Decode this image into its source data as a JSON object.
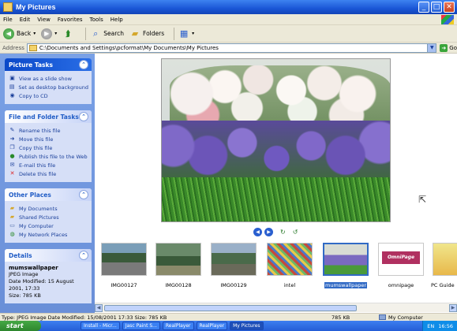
{
  "window": {
    "title": "My Pictures"
  },
  "menu": [
    "File",
    "Edit",
    "View",
    "Favorites",
    "Tools",
    "Help"
  ],
  "toolbar": {
    "back": "Back",
    "search": "Search",
    "folders": "Folders"
  },
  "address": {
    "label": "Address",
    "path": "C:\\Documents and Settings\\pcformat\\My Documents\\My Pictures",
    "go": "Go"
  },
  "picture_tasks": {
    "title": "Picture Tasks",
    "items": [
      "View as a slide show",
      "Set as desktop background",
      "Copy to CD"
    ]
  },
  "file_tasks": {
    "title": "File and Folder Tasks",
    "items": [
      "Rename this file",
      "Move this file",
      "Copy this file",
      "Publish this file to the Web",
      "E-mail this file",
      "Delete this file"
    ]
  },
  "other_places": {
    "title": "Other Places",
    "items": [
      "My Documents",
      "Shared Pictures",
      "My Computer",
      "My Network Places"
    ]
  },
  "details": {
    "title": "Details",
    "name": "mumswallpaper",
    "type": "JPEG Image",
    "modified": "Date Modified: 15 August 2001, 17:33",
    "size": "Size: 785 KB"
  },
  "thumbnails": [
    "IMG00127",
    "IMG00128",
    "IMG00129",
    "intel",
    "mumswallpaper",
    "omnipage",
    "PC Guide"
  ],
  "omnipage_logo": "OmniPage",
  "status": {
    "info": "Type: JPEG Image Date Modified: 15/08/2001 17:33 Size: 785 KB",
    "size": "785 KB",
    "location": "My Computer"
  },
  "taskbar": {
    "start": "start",
    "items": [
      "Install - Micr...",
      "Jasc Paint S...",
      "RealPlayer",
      "RealPlayer",
      "My Pictures"
    ],
    "lang": "EN",
    "clock": "16:56"
  }
}
